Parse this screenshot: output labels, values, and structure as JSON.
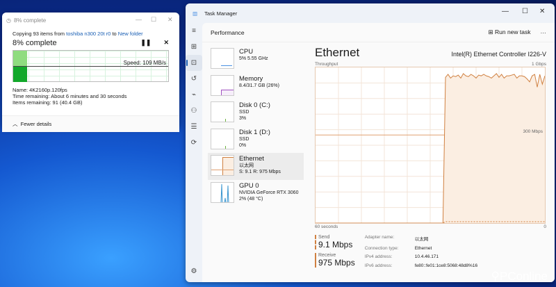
{
  "copy_dialog": {
    "title": "8% complete",
    "copying_prefix": "Copying 93 items from",
    "source": "toshiba n300 20t r0",
    "to": "to",
    "dest": "New folder",
    "percent_label": "8% complete",
    "progress": 0.08,
    "speed": "Speed: 109 MB/s",
    "name": "Name: 4K2160p.120fps",
    "time_remaining": "Time remaining: About 6 minutes and 30 seconds",
    "items_remaining": "Items remaining: 91 (40.4 GB)",
    "fewer_details": "Fewer details"
  },
  "task_manager": {
    "title": "Task Manager",
    "section": "Performance",
    "run_new_task": "Run new task",
    "items": [
      {
        "name": "CPU",
        "sub1": "5% 5.55 GHz",
        "sub2": ""
      },
      {
        "name": "Memory",
        "sub1": "8.4/31.7 GB (26%)",
        "sub2": ""
      },
      {
        "name": "Disk 0 (C:)",
        "sub1": "SSD",
        "sub2": "3%"
      },
      {
        "name": "Disk 1 (D:)",
        "sub1": "SSD",
        "sub2": "0%"
      },
      {
        "name": "Ethernet",
        "sub1": "以太网",
        "sub2": "S: 9.1 R: 975 Mbps"
      },
      {
        "name": "GPU 0",
        "sub1": "NVIDIA GeForce RTX 3060",
        "sub2": "2% (48 °C)"
      }
    ],
    "heading": "Ethernet",
    "adapter": "Intel(R) Ethernet Controller I226-V",
    "throughput_label": "Throughput",
    "max_label": "1 Gbps",
    "mid_label": "300 Mbps",
    "time_label": "60 seconds",
    "zero_label": "0",
    "send_label": "Send",
    "send_value": "9.1 Mbps",
    "receive_label": "Receive",
    "receive_value": "975 Mbps",
    "details": [
      [
        "Adapter name:",
        "以太网"
      ],
      [
        "Connection type:",
        "Ethernet"
      ],
      [
        "IPv4 address:",
        "10.4.46.171"
      ],
      [
        "IPv6 address:",
        "fe80::fe01:1ce8:5068:48d8%16"
      ]
    ]
  },
  "chart_data": {
    "type": "area",
    "ylim": [
      0,
      1000
    ],
    "xlabel": "60 seconds",
    "unit": "Mbps",
    "accent": "#d08040",
    "receive": [
      0,
      0,
      0,
      0,
      0,
      0,
      0,
      0,
      0,
      0,
      0,
      0,
      0,
      0,
      0,
      0,
      0,
      0,
      0,
      0,
      0,
      0,
      0,
      0,
      0,
      0,
      0,
      0,
      0,
      0,
      0,
      0,
      0,
      0,
      0,
      0,
      0,
      0,
      0,
      0,
      0,
      0,
      0,
      0,
      0,
      0,
      0,
      0,
      0,
      0,
      0,
      965,
      985,
      960,
      975,
      970,
      980,
      960,
      990,
      975,
      970,
      985,
      975,
      960,
      980,
      975,
      985,
      975,
      970,
      960,
      975,
      990,
      965,
      985,
      960,
      975,
      975,
      980,
      985,
      960,
      975,
      975,
      970,
      955,
      935,
      975,
      985,
      900,
      985,
      920,
      975
    ],
    "send": [
      0,
      0,
      0,
      0,
      0,
      0,
      0,
      0,
      0,
      0,
      0,
      0,
      0,
      0,
      0,
      0,
      0,
      0,
      0,
      0,
      0,
      0,
      0,
      0,
      0,
      0,
      0,
      0,
      0,
      0,
      0,
      0,
      0,
      0,
      0,
      0,
      0,
      0,
      0,
      0,
      0,
      0,
      0,
      0,
      0,
      0,
      0,
      0,
      0,
      0,
      0,
      9,
      9,
      9,
      9,
      9,
      9,
      9,
      9,
      9,
      9,
      9,
      9,
      9,
      9,
      9,
      9,
      9,
      9,
      9,
      9,
      9,
      9,
      9,
      9,
      9,
      9,
      9,
      9,
      9,
      9,
      9,
      9,
      9,
      9,
      9,
      9,
      9,
      9,
      9,
      9
    ]
  }
}
